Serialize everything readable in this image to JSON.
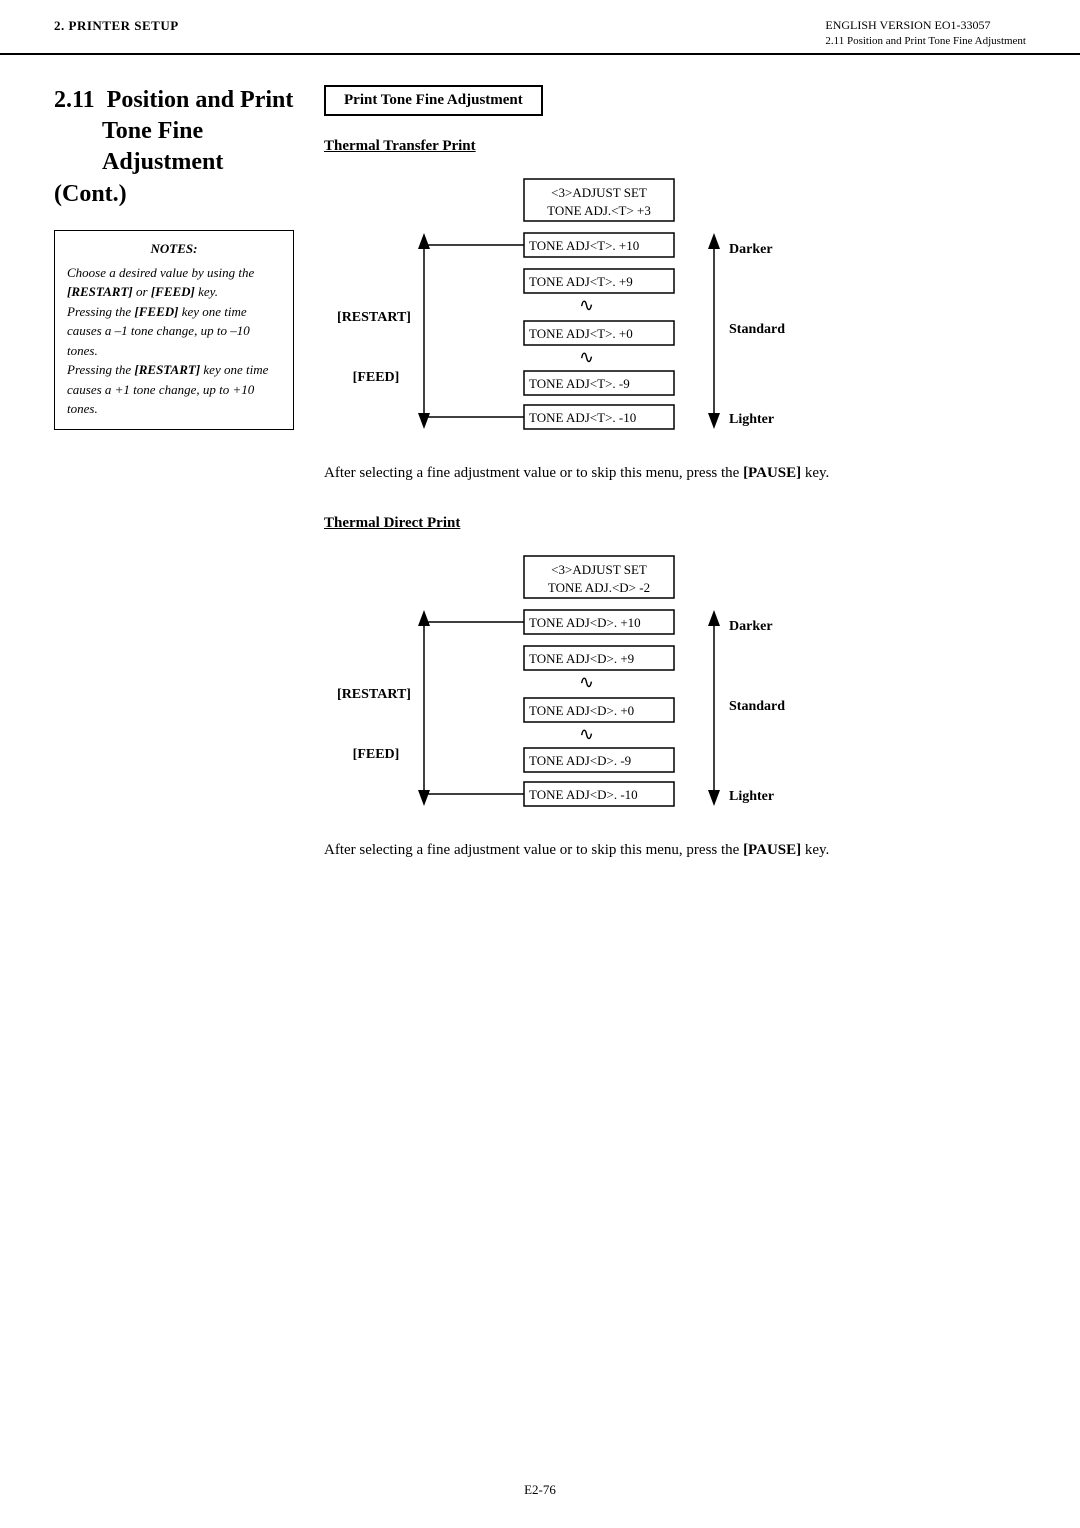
{
  "header": {
    "left": "2. PRINTER SETUP",
    "right_top": "ENGLISH VERSION EO1-33057",
    "right_bottom": "2.11 Position and Print Tone Fine Adjustment"
  },
  "section": {
    "number": "2.11",
    "title": "Position and Print\nTone Fine\nAdjustment (Cont.)"
  },
  "box_title": "Print Tone Fine Adjustment",
  "notes": {
    "title": "NOTES:",
    "line1": "Choose a desired value by using the",
    "line2_bold": "[RESTART]",
    "line2_rest": " or ",
    "line2_bold2": "[FEED]",
    "line2_end": " key.",
    "line3": "Pressing the ",
    "line3_bold": "[FEED]",
    "line3_rest": " key one time causes a –1 tone change, up to –10 tones.",
    "line4": "Pressing the ",
    "line4_bold": "[RESTART]",
    "line4_rest": " key one time causes a +1 tone change, up to +10 tones."
  },
  "thermal_transfer": {
    "subtitle": "Thermal Transfer Print",
    "adjust_set_line1": "<3>ADJUST SET",
    "adjust_set_line2": "TONE ADJ.<T> +3",
    "tones": [
      "TONE ADJ<T>. +10",
      "TONE ADJ<T>. +9",
      "TONE ADJ<T>. +0",
      "TONE ADJ<T>. -9",
      "TONE ADJ<T>. -10"
    ],
    "restart_label": "[RESTART]",
    "feed_label": "[FEED]",
    "darker_label": "Darker",
    "standard_label": "Standard",
    "lighter_label": "Lighter"
  },
  "after_text_1": "After selecting a fine adjustment value or to skip this menu, press the",
  "pause_key_1": "[PAUSE]",
  "key_suffix_1": " key.",
  "thermal_direct": {
    "subtitle": "Thermal Direct Print",
    "adjust_set_line1": "<3>ADJUST SET",
    "adjust_set_line2": "TONE ADJ.<D> -2",
    "tones": [
      "TONE ADJ<D>. +10",
      "TONE ADJ<D>. +9",
      "TONE ADJ<D>. +0",
      "TONE ADJ<D>. -9",
      "TONE ADJ<D>. -10"
    ],
    "restart_label": "[RESTART]",
    "feed_label": "[FEED]",
    "darker_label": "Darker",
    "standard_label": "Standard",
    "lighter_label": "Lighter"
  },
  "after_text_2": "After selecting a fine adjustment value or to skip this menu, press the",
  "pause_key_2": "[PAUSE]",
  "key_suffix_2": " key.",
  "footer": "E2-76"
}
